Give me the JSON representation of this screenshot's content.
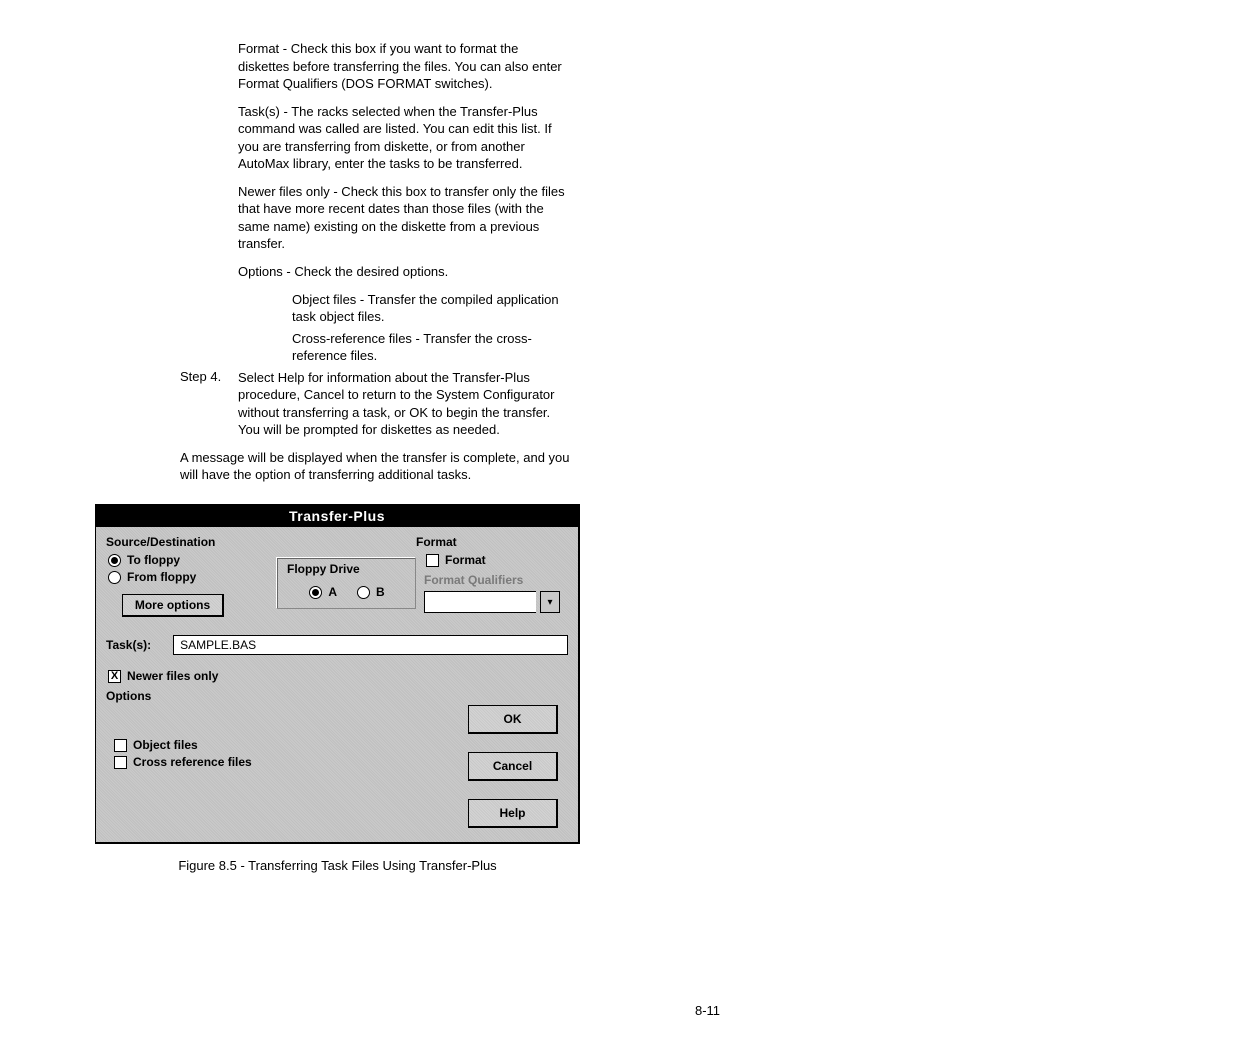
{
  "paragraphs": {
    "format": "Format - Check this box if you want to format the diskettes before transferring the files. You can also enter Format Qualifiers (DOS FORMAT switches).",
    "tasks": "Task(s) - The racks selected when the Transfer-Plus command was called are listed. You can edit this list. If you are transferring from diskette, or from another AutoMax library, enter the tasks to be transferred.",
    "newer": "Newer files only - Check this box to transfer only the files that have more recent dates than those files (with the same name) existing on the diskette from a previous transfer.",
    "options": "Options - Check the desired options.",
    "object_files": "Object files - Transfer the compiled application task object files.",
    "cross_ref": "Cross-reference files - Transfer the cross-reference files."
  },
  "step4": {
    "label": "Step 4.",
    "text": "Select Help for information about the Transfer-Plus procedure, Cancel to return to the System Configurator without transferring a task, or OK to begin the transfer. You will be prompted for diskettes as needed."
  },
  "message": "A message will be displayed when the transfer is complete, and you will have the option of transferring additional tasks.",
  "dialog": {
    "title": "Transfer-Plus",
    "source_dest": "Source/Destination",
    "to_floppy": "To floppy",
    "from_floppy": "From floppy",
    "more_options": "More options",
    "floppy_drive": "Floppy Drive",
    "drive_a": "A",
    "drive_b": "B",
    "format_heading": "Format",
    "format_check": "Format",
    "format_qualifiers": "Format Qualifiers",
    "tasks_label": "Task(s):",
    "tasks_value": "SAMPLE.BAS",
    "newer_files": "Newer files only",
    "options_label": "Options",
    "object_files": "Object files",
    "cross_reference": "Cross reference files",
    "ok": "OK",
    "cancel": "Cancel",
    "help": "Help"
  },
  "caption": "Figure 8.5 - Transferring Task Files Using Transfer-Plus",
  "page_number": "8-11"
}
